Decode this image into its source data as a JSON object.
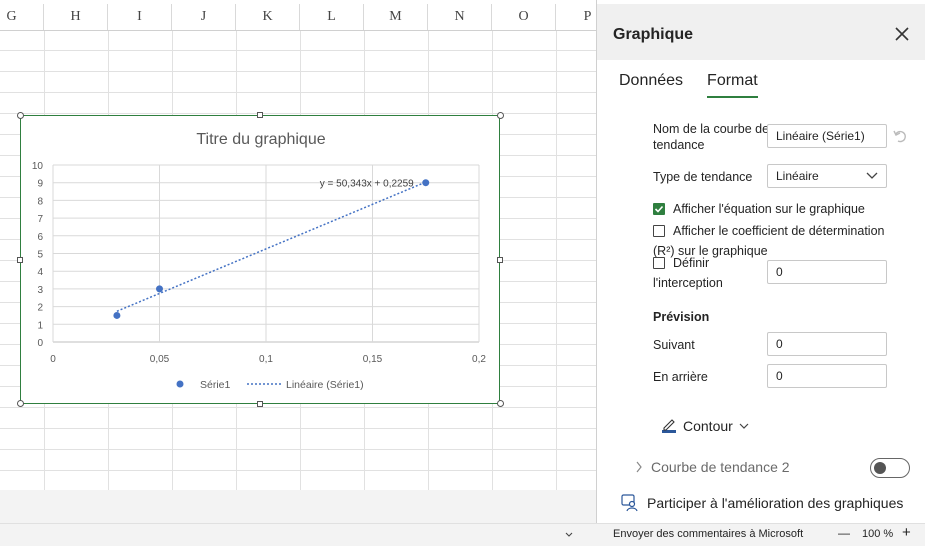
{
  "sheet": {
    "columns": [
      "G",
      "H",
      "I",
      "J",
      "K",
      "L",
      "M",
      "N",
      "O",
      "P"
    ]
  },
  "chart_data": {
    "type": "scatter",
    "title": "Titre du graphique",
    "xlim": [
      0,
      0.2
    ],
    "ylim": [
      0,
      10
    ],
    "x_ticks": [
      "0",
      "0,05",
      "0,1",
      "0,15",
      "0,2"
    ],
    "y_ticks": [
      "0",
      "1",
      "2",
      "3",
      "4",
      "5",
      "6",
      "7",
      "8",
      "9",
      "10"
    ],
    "grid": true,
    "legend_position": "bottom",
    "series": [
      {
        "name": "Série1",
        "x": [
          0.03,
          0.05,
          0.175
        ],
        "y": [
          1.5,
          3.0,
          9.0
        ],
        "color": "#4472c4"
      }
    ],
    "trendline": {
      "name": "Linéaire (Série1)",
      "type": "linear",
      "slope": 50.343,
      "intercept": 0.2259,
      "x_range": [
        0.03,
        0.175
      ],
      "color": "#4472c4"
    },
    "equation_label": "y = 50,343x + 0,2259"
  },
  "pane": {
    "title": "Graphique",
    "tabs": [
      {
        "label": "Données"
      },
      {
        "label": "Format"
      }
    ],
    "active_tab": "Format",
    "trend_name_label_1": "Nom de la courbe de",
    "trend_name_label_2": "tendance",
    "trend_name_value": "Linéaire (Série1)",
    "trend_type_label": "Type de tendance",
    "trend_type_value": "Linéaire",
    "show_equation_label": "Afficher l'équation sur le graphique",
    "show_equation_checked": true,
    "show_r2_label_1": "Afficher le coefficient de détermination",
    "show_r2_label_2": "(R²) sur le graphique",
    "show_r2_checked": false,
    "intercept_label_1": "Définir",
    "intercept_label_2": "l'interception",
    "intercept_checked": false,
    "intercept_value": "0",
    "forecast_heading": "Prévision",
    "forward_label": "Suivant",
    "forward_value": "0",
    "backward_label": "En arrière",
    "backward_value": "0",
    "contour_label": "Contour",
    "trendline2_label": "Courbe de tendance 2",
    "improve_label": "Participer à l'amélioration des graphiques"
  },
  "status": {
    "feedback": "Envoyer des commentaires à Microsoft",
    "zoom": "100 %",
    "minus": "—",
    "plus": "+"
  }
}
